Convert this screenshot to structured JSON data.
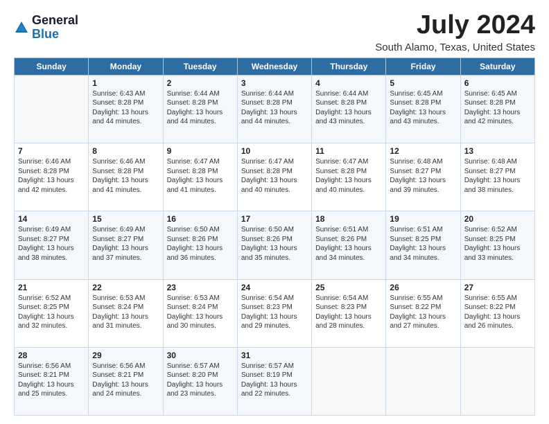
{
  "header": {
    "logo_general": "General",
    "logo_blue": "Blue",
    "title": "July 2024",
    "subtitle": "South Alamo, Texas, United States"
  },
  "weekdays": [
    "Sunday",
    "Monday",
    "Tuesday",
    "Wednesday",
    "Thursday",
    "Friday",
    "Saturday"
  ],
  "weeks": [
    [
      {
        "day": "",
        "sunrise": "",
        "sunset": "",
        "daylight": ""
      },
      {
        "day": "1",
        "sunrise": "Sunrise: 6:43 AM",
        "sunset": "Sunset: 8:28 PM",
        "daylight": "Daylight: 13 hours and 44 minutes."
      },
      {
        "day": "2",
        "sunrise": "Sunrise: 6:44 AM",
        "sunset": "Sunset: 8:28 PM",
        "daylight": "Daylight: 13 hours and 44 minutes."
      },
      {
        "day": "3",
        "sunrise": "Sunrise: 6:44 AM",
        "sunset": "Sunset: 8:28 PM",
        "daylight": "Daylight: 13 hours and 44 minutes."
      },
      {
        "day": "4",
        "sunrise": "Sunrise: 6:44 AM",
        "sunset": "Sunset: 8:28 PM",
        "daylight": "Daylight: 13 hours and 43 minutes."
      },
      {
        "day": "5",
        "sunrise": "Sunrise: 6:45 AM",
        "sunset": "Sunset: 8:28 PM",
        "daylight": "Daylight: 13 hours and 43 minutes."
      },
      {
        "day": "6",
        "sunrise": "Sunrise: 6:45 AM",
        "sunset": "Sunset: 8:28 PM",
        "daylight": "Daylight: 13 hours and 42 minutes."
      }
    ],
    [
      {
        "day": "7",
        "sunrise": "Sunrise: 6:46 AM",
        "sunset": "Sunset: 8:28 PM",
        "daylight": "Daylight: 13 hours and 42 minutes."
      },
      {
        "day": "8",
        "sunrise": "Sunrise: 6:46 AM",
        "sunset": "Sunset: 8:28 PM",
        "daylight": "Daylight: 13 hours and 41 minutes."
      },
      {
        "day": "9",
        "sunrise": "Sunrise: 6:47 AM",
        "sunset": "Sunset: 8:28 PM",
        "daylight": "Daylight: 13 hours and 41 minutes."
      },
      {
        "day": "10",
        "sunrise": "Sunrise: 6:47 AM",
        "sunset": "Sunset: 8:28 PM",
        "daylight": "Daylight: 13 hours and 40 minutes."
      },
      {
        "day": "11",
        "sunrise": "Sunrise: 6:47 AM",
        "sunset": "Sunset: 8:28 PM",
        "daylight": "Daylight: 13 hours and 40 minutes."
      },
      {
        "day": "12",
        "sunrise": "Sunrise: 6:48 AM",
        "sunset": "Sunset: 8:27 PM",
        "daylight": "Daylight: 13 hours and 39 minutes."
      },
      {
        "day": "13",
        "sunrise": "Sunrise: 6:48 AM",
        "sunset": "Sunset: 8:27 PM",
        "daylight": "Daylight: 13 hours and 38 minutes."
      }
    ],
    [
      {
        "day": "14",
        "sunrise": "Sunrise: 6:49 AM",
        "sunset": "Sunset: 8:27 PM",
        "daylight": "Daylight: 13 hours and 38 minutes."
      },
      {
        "day": "15",
        "sunrise": "Sunrise: 6:49 AM",
        "sunset": "Sunset: 8:27 PM",
        "daylight": "Daylight: 13 hours and 37 minutes."
      },
      {
        "day": "16",
        "sunrise": "Sunrise: 6:50 AM",
        "sunset": "Sunset: 8:26 PM",
        "daylight": "Daylight: 13 hours and 36 minutes."
      },
      {
        "day": "17",
        "sunrise": "Sunrise: 6:50 AM",
        "sunset": "Sunset: 8:26 PM",
        "daylight": "Daylight: 13 hours and 35 minutes."
      },
      {
        "day": "18",
        "sunrise": "Sunrise: 6:51 AM",
        "sunset": "Sunset: 8:26 PM",
        "daylight": "Daylight: 13 hours and 34 minutes."
      },
      {
        "day": "19",
        "sunrise": "Sunrise: 6:51 AM",
        "sunset": "Sunset: 8:25 PM",
        "daylight": "Daylight: 13 hours and 34 minutes."
      },
      {
        "day": "20",
        "sunrise": "Sunrise: 6:52 AM",
        "sunset": "Sunset: 8:25 PM",
        "daylight": "Daylight: 13 hours and 33 minutes."
      }
    ],
    [
      {
        "day": "21",
        "sunrise": "Sunrise: 6:52 AM",
        "sunset": "Sunset: 8:25 PM",
        "daylight": "Daylight: 13 hours and 32 minutes."
      },
      {
        "day": "22",
        "sunrise": "Sunrise: 6:53 AM",
        "sunset": "Sunset: 8:24 PM",
        "daylight": "Daylight: 13 hours and 31 minutes."
      },
      {
        "day": "23",
        "sunrise": "Sunrise: 6:53 AM",
        "sunset": "Sunset: 8:24 PM",
        "daylight": "Daylight: 13 hours and 30 minutes."
      },
      {
        "day": "24",
        "sunrise": "Sunrise: 6:54 AM",
        "sunset": "Sunset: 8:23 PM",
        "daylight": "Daylight: 13 hours and 29 minutes."
      },
      {
        "day": "25",
        "sunrise": "Sunrise: 6:54 AM",
        "sunset": "Sunset: 8:23 PM",
        "daylight": "Daylight: 13 hours and 28 minutes."
      },
      {
        "day": "26",
        "sunrise": "Sunrise: 6:55 AM",
        "sunset": "Sunset: 8:22 PM",
        "daylight": "Daylight: 13 hours and 27 minutes."
      },
      {
        "day": "27",
        "sunrise": "Sunrise: 6:55 AM",
        "sunset": "Sunset: 8:22 PM",
        "daylight": "Daylight: 13 hours and 26 minutes."
      }
    ],
    [
      {
        "day": "28",
        "sunrise": "Sunrise: 6:56 AM",
        "sunset": "Sunset: 8:21 PM",
        "daylight": "Daylight: 13 hours and 25 minutes."
      },
      {
        "day": "29",
        "sunrise": "Sunrise: 6:56 AM",
        "sunset": "Sunset: 8:21 PM",
        "daylight": "Daylight: 13 hours and 24 minutes."
      },
      {
        "day": "30",
        "sunrise": "Sunrise: 6:57 AM",
        "sunset": "Sunset: 8:20 PM",
        "daylight": "Daylight: 13 hours and 23 minutes."
      },
      {
        "day": "31",
        "sunrise": "Sunrise: 6:57 AM",
        "sunset": "Sunset: 8:19 PM",
        "daylight": "Daylight: 13 hours and 22 minutes."
      },
      {
        "day": "",
        "sunrise": "",
        "sunset": "",
        "daylight": ""
      },
      {
        "day": "",
        "sunrise": "",
        "sunset": "",
        "daylight": ""
      },
      {
        "day": "",
        "sunrise": "",
        "sunset": "",
        "daylight": ""
      }
    ]
  ]
}
